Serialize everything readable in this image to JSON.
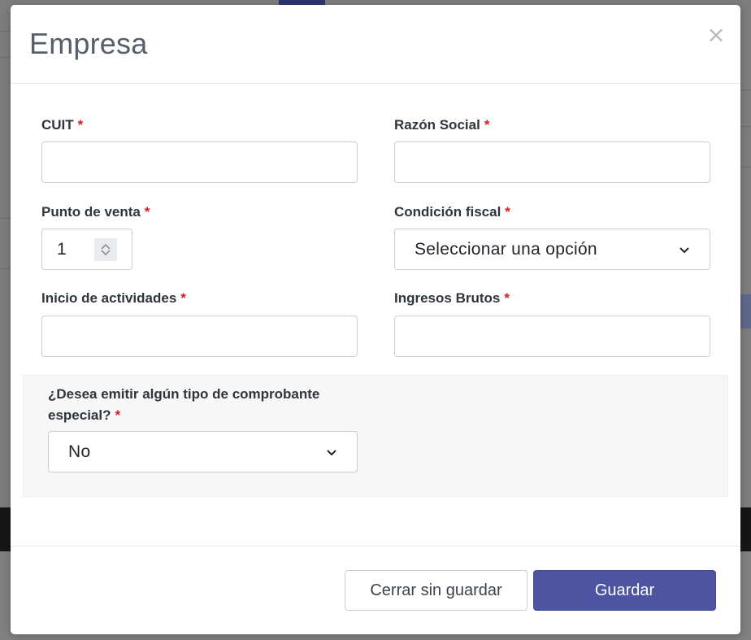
{
  "modal": {
    "title": "Empresa",
    "close_symbol": "×"
  },
  "form": {
    "cuit": {
      "label": "CUIT",
      "required_mark": "*",
      "value": ""
    },
    "razon_social": {
      "label": "Razón Social",
      "required_mark": "*",
      "value": ""
    },
    "punto_venta": {
      "label": "Punto de venta",
      "required_mark": "*",
      "value": "1"
    },
    "condicion_fiscal": {
      "label": "Condición fiscal",
      "required_mark": "*",
      "selected": "Seleccionar una opción"
    },
    "inicio_actividades": {
      "label": "Inicio de actividades",
      "required_mark": "*",
      "value": ""
    },
    "ingresos_brutos": {
      "label": "Ingresos Brutos",
      "required_mark": "*",
      "value": ""
    },
    "comprobante_especial": {
      "label": "¿Desea emitir algún tipo de comprobante especial?",
      "required_mark": "*",
      "selected": "No"
    }
  },
  "footer": {
    "cancel_label": "Cerrar sin guardar",
    "save_label": "Guardar"
  },
  "icons": {
    "close": "close-icon",
    "dropdown": "chevron-down-icon",
    "spinner_up": "chevron-up-icon",
    "spinner_down": "chevron-down-icon"
  },
  "colors": {
    "primary": "#4d55a3",
    "required": "#d01f2a",
    "title": "#555f6b",
    "panel_bg": "#f7f7f8"
  }
}
